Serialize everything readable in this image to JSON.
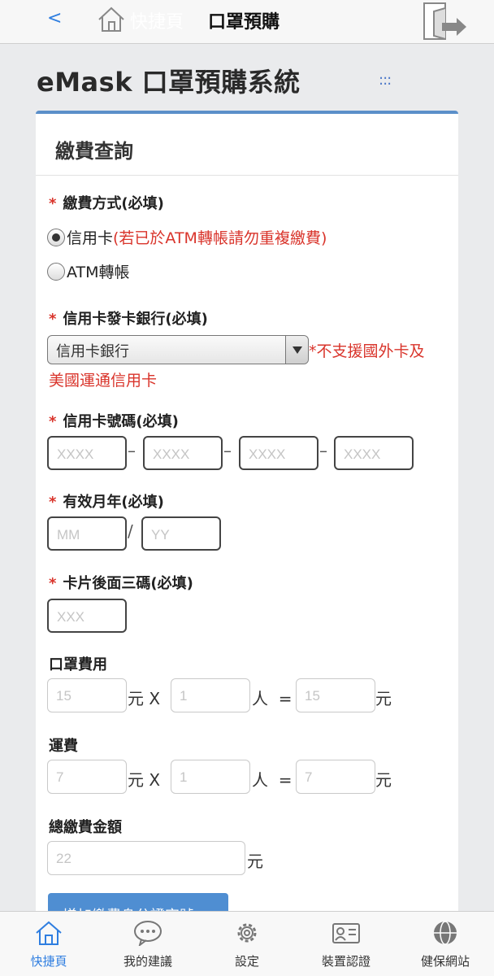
{
  "header": {
    "back": "<",
    "home_label": "快捷頁",
    "title": "口罩預購"
  },
  "system_title": "eMask 口罩預購系統",
  "menu_dots": ":::",
  "card": {
    "title": "繳費查詢",
    "payment_method": {
      "label": "繳費方式(必填)",
      "options": [
        {
          "label": "信用卡",
          "note": "(若已於ATM轉帳請勿重複繳費)",
          "checked": true
        },
        {
          "label": "ATM轉帳",
          "note": "",
          "checked": false
        }
      ]
    },
    "bank": {
      "label": "信用卡發卡銀行(必填)",
      "selected": "信用卡銀行",
      "note_line1": "*不支援國外卡及",
      "note_line2": "美國運通信用卡"
    },
    "card_number": {
      "label": "信用卡號碼(必填)",
      "placeholders": [
        "XXXX",
        "XXXX",
        "XXXX",
        "XXXX"
      ],
      "separator": "–"
    },
    "expiry": {
      "label": "有效月年(必填)",
      "month_placeholder": "MM",
      "year_placeholder": "YY",
      "separator": "/"
    },
    "cvv": {
      "label": "卡片後面三碼(必填)",
      "placeholder": "XXX"
    },
    "mask_fee": {
      "label": "口罩費用",
      "unit_price": "15",
      "unit": "元",
      "times": "X",
      "people": "1",
      "people_unit": "人",
      "equals": "=",
      "total": "15",
      "total_unit": "元"
    },
    "shipping": {
      "label": "運費",
      "unit_price": "7",
      "unit": "元",
      "times": "X",
      "people": "1",
      "people_unit": "人",
      "equals": "=",
      "total": "7",
      "total_unit": "元"
    },
    "total": {
      "label": "總繳費金額",
      "value": "22",
      "unit": "元"
    },
    "add_button": "增加繳費身分證字號"
  },
  "tabbar": {
    "items": [
      {
        "label": "快捷頁",
        "icon": "home-icon",
        "active": true
      },
      {
        "label": "我的建議",
        "icon": "chat-bubble-icon",
        "active": false
      },
      {
        "label": "設定",
        "icon": "gear-icon",
        "active": false
      },
      {
        "label": "裝置認證",
        "icon": "id-card-icon",
        "active": false
      },
      {
        "label": "健保網站",
        "icon": "globe-icon",
        "active": false
      }
    ]
  },
  "colors": {
    "accent": "#2f7ee0",
    "required_star": "#d9342b",
    "card_border": "#5b8fc9",
    "button": "#4f8ed2"
  }
}
